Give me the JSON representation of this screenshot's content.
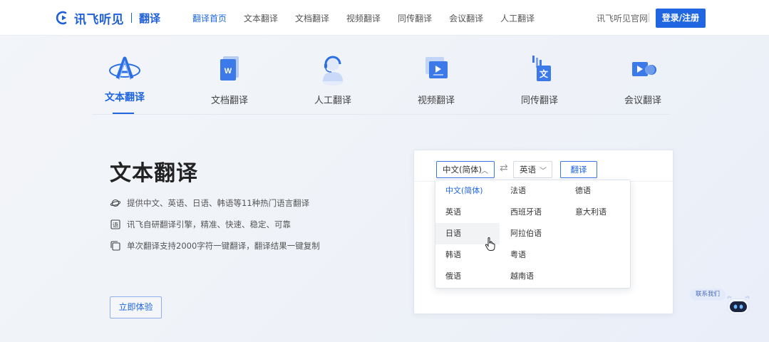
{
  "header": {
    "logo_text": "讯飞听见",
    "logo_sub": "翻译",
    "nav": [
      {
        "label": "翻译首页",
        "active": true
      },
      {
        "label": "文本翻译",
        "active": false
      },
      {
        "label": "文档翻译",
        "active": false
      },
      {
        "label": "视频翻译",
        "active": false
      },
      {
        "label": "同传翻译",
        "active": false
      },
      {
        "label": "会议翻译",
        "active": false
      },
      {
        "label": "人工翻译",
        "active": false
      }
    ],
    "official_site": "讯飞听见官网",
    "login_label": "登录/注册"
  },
  "tabs": [
    {
      "label": "文本翻译",
      "icon": "text-translate-icon",
      "active": true
    },
    {
      "label": "文档翻译",
      "icon": "document-icon",
      "active": false
    },
    {
      "label": "人工翻译",
      "icon": "human-agent-icon",
      "active": false
    },
    {
      "label": "视频翻译",
      "icon": "video-icon",
      "active": false
    },
    {
      "label": "同传翻译",
      "icon": "simultaneous-icon",
      "active": false
    },
    {
      "label": "会议翻译",
      "icon": "meeting-icon",
      "active": false
    }
  ],
  "main": {
    "title": "文本翻译",
    "features": [
      {
        "icon": "planet-icon",
        "text": "提供中文、英语、日语、韩语等11种热门语言翻译"
      },
      {
        "icon": "translate-char-icon",
        "text": "讯飞自研翻译引擎，精准、快速、稳定、可靠"
      },
      {
        "icon": "copy-icon",
        "text": "单次翻译支持2000字符一键翻译，翻译结果一键复制"
      }
    ],
    "try_label": "立即体验"
  },
  "translator": {
    "source_lang": "中文(简体)",
    "target_lang": "英语",
    "translate_label": "翻译",
    "options": [
      {
        "label": "中文(简体)",
        "selected": true
      },
      {
        "label": "英语"
      },
      {
        "label": "日语",
        "hover": true
      },
      {
        "label": "韩语"
      },
      {
        "label": "俄语"
      },
      {
        "label": "法语"
      },
      {
        "label": "西班牙语"
      },
      {
        "label": "阿拉伯语"
      },
      {
        "label": "粤语"
      },
      {
        "label": "越南语"
      },
      {
        "label": "德语"
      },
      {
        "label": "意大利语"
      }
    ]
  },
  "contact": {
    "label": "联系我们"
  },
  "colors": {
    "accent": "#1f66e0",
    "text": "#333333",
    "muted": "#555555"
  }
}
